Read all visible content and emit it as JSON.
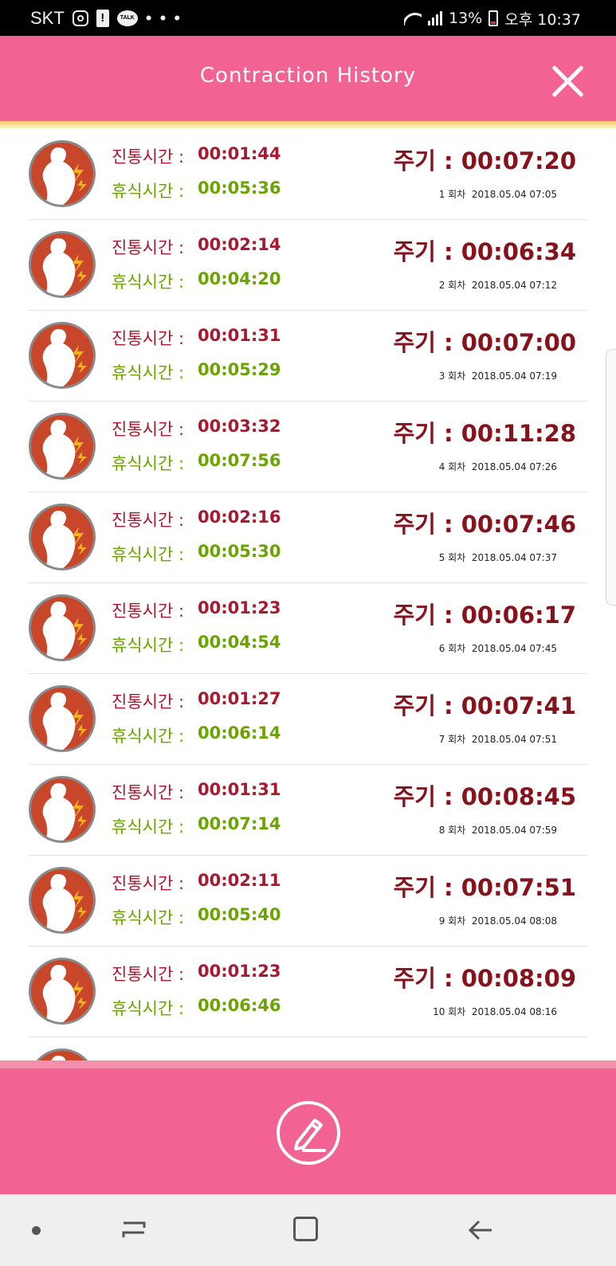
{
  "status_bar": {
    "carrier": "SKT",
    "battery_percent": "13%",
    "time": "오후 10:37",
    "icons": [
      "instagram-icon",
      "alert-icon",
      "kakaotalk-icon",
      "more-dots-icon",
      "wifi-icon",
      "signal-icon",
      "battery-icon"
    ],
    "talk_label": "TALK",
    "alert_label": "!",
    "dots": "• • •"
  },
  "header": {
    "title": "Contraction History",
    "close_icon": "close-icon",
    "background": "#f26393"
  },
  "labels": {
    "pain": "진통시간 :",
    "rest": "휴식시간 :",
    "cycle_prefix": "주기 : "
  },
  "records": [
    {
      "pain": "00:01:44",
      "rest": "00:05:36",
      "cycle": "00:07:20",
      "count": "1 회차",
      "datetime": "2018.05.04 07:05"
    },
    {
      "pain": "00:02:14",
      "rest": "00:04:20",
      "cycle": "00:06:34",
      "count": "2 회차",
      "datetime": "2018.05.04 07:12"
    },
    {
      "pain": "00:01:31",
      "rest": "00:05:29",
      "cycle": "00:07:00",
      "count": "3 회차",
      "datetime": "2018.05.04 07:19"
    },
    {
      "pain": "00:03:32",
      "rest": "00:07:56",
      "cycle": "00:11:28",
      "count": "4 회차",
      "datetime": "2018.05.04 07:26"
    },
    {
      "pain": "00:02:16",
      "rest": "00:05:30",
      "cycle": "00:07:46",
      "count": "5 회차",
      "datetime": "2018.05.04 07:37"
    },
    {
      "pain": "00:01:23",
      "rest": "00:04:54",
      "cycle": "00:06:17",
      "count": "6 회차",
      "datetime": "2018.05.04 07:45"
    },
    {
      "pain": "00:01:27",
      "rest": "00:06:14",
      "cycle": "00:07:41",
      "count": "7 회차",
      "datetime": "2018.05.04 07:51"
    },
    {
      "pain": "00:01:31",
      "rest": "00:07:14",
      "cycle": "00:08:45",
      "count": "8 회차",
      "datetime": "2018.05.04 07:59"
    },
    {
      "pain": "00:02:11",
      "rest": "00:05:40",
      "cycle": "00:07:51",
      "count": "9 회차",
      "datetime": "2018.05.04 08:08"
    },
    {
      "pain": "00:01:23",
      "rest": "00:06:46",
      "cycle": "00:08:09",
      "count": "10 회차",
      "datetime": "2018.05.04 08:16"
    }
  ],
  "colors": {
    "pain": "#a8182e",
    "rest": "#6aa400",
    "cycle": "#86131c",
    "avatar": "#c8472a",
    "accent": "#f26393"
  },
  "bottom_bar": {
    "edit_icon": "pencil-edit-icon"
  },
  "nav_bar": {
    "icons": [
      "nav-dot-icon",
      "recent-apps-icon",
      "home-icon",
      "back-icon"
    ]
  }
}
